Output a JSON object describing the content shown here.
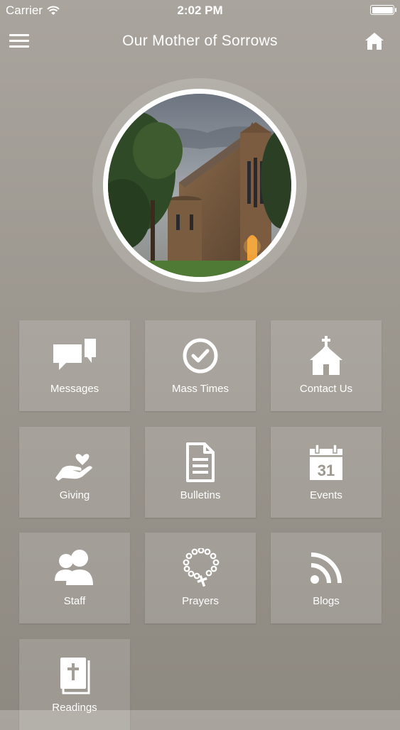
{
  "status_bar": {
    "carrier": "Carrier",
    "time": "2:02 PM",
    "battery_level": 1.0
  },
  "nav": {
    "title": "Our Mother of Sorrows",
    "menu_icon": "hamburger-icon",
    "home_icon": "home-icon"
  },
  "hero": {
    "image": "church photo"
  },
  "tiles": [
    {
      "label": "Messages",
      "icon": "chat-bubbles-icon"
    },
    {
      "label": "Mass Times",
      "icon": "clock-check-icon"
    },
    {
      "label": "Contact Us",
      "icon": "church-building-icon"
    },
    {
      "label": "Giving",
      "icon": "hand-heart-icon"
    },
    {
      "label": "Bulletins",
      "icon": "document-icon"
    },
    {
      "label": "Events",
      "icon": "calendar-icon"
    },
    {
      "label": "Staff",
      "icon": "people-icon"
    },
    {
      "label": "Prayers",
      "icon": "rosary-icon"
    },
    {
      "label": "Blogs",
      "icon": "rss-icon"
    },
    {
      "label": "Readings",
      "icon": "bible-icon"
    }
  ],
  "calendar_day": "31"
}
